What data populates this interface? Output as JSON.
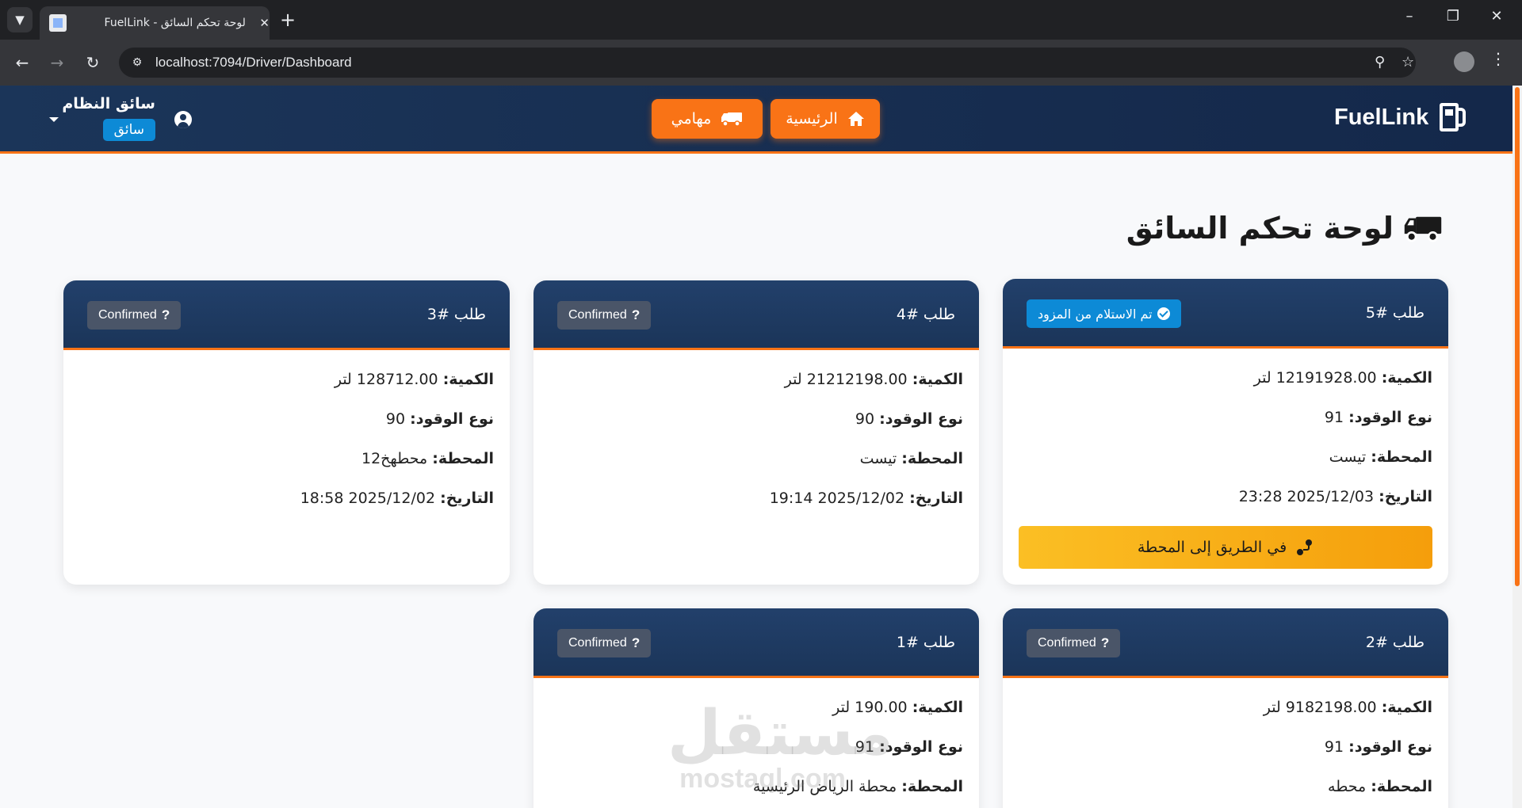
{
  "browser": {
    "tab_title": "FuelLink - لوحة تحكم السائق",
    "url": "localhost:7094/Driver/Dashboard"
  },
  "navbar": {
    "brand": "FuelLink",
    "home_label": "الرئيسية",
    "tasks_label": "مهامي",
    "user_name": "سائق النظام",
    "user_role": "سائق"
  },
  "page": {
    "title": "لوحة تحكم السائق"
  },
  "labels": {
    "quantity": "الكمية:",
    "fuel_type": "نوع الوقود:",
    "station": "المحطة:",
    "date": "التاريخ:"
  },
  "orders": [
    {
      "number": "طلب #5",
      "status": "تم الاستلام من المزود",
      "quantity": "12191928.00 لتر",
      "fuel_type": "91",
      "station": "تيست",
      "date": "2025/12/03 23:28",
      "action": "في الطريق إلى المحطة"
    },
    {
      "number": "طلب #4",
      "status": "Confirmed",
      "quantity": "21212198.00 لتر",
      "fuel_type": "90",
      "station": "تيست",
      "date": "2025/12/02 19:14"
    },
    {
      "number": "طلب #3",
      "status": "Confirmed",
      "quantity": "128712.00 لتر",
      "fuel_type": "90",
      "station": "محطهخ12",
      "date": "2025/12/02 18:58"
    },
    {
      "number": "طلب #2",
      "status": "Confirmed",
      "quantity": "9182198.00 لتر",
      "fuel_type": "91",
      "station": "محطه"
    },
    {
      "number": "طلب #1",
      "status": "Confirmed",
      "quantity": "190.00 لتر",
      "fuel_type": "91",
      "station": "محطة الرياض الرئيسية"
    }
  ],
  "watermark": {
    "arabic": "مستقل",
    "latin": "mostaql.com"
  },
  "colors": {
    "navy": "#1b3559",
    "orange": "#f97316",
    "blue_badge": "#0d8ad6",
    "gray_badge": "#4a5568",
    "amber": "#fbbf24"
  }
}
